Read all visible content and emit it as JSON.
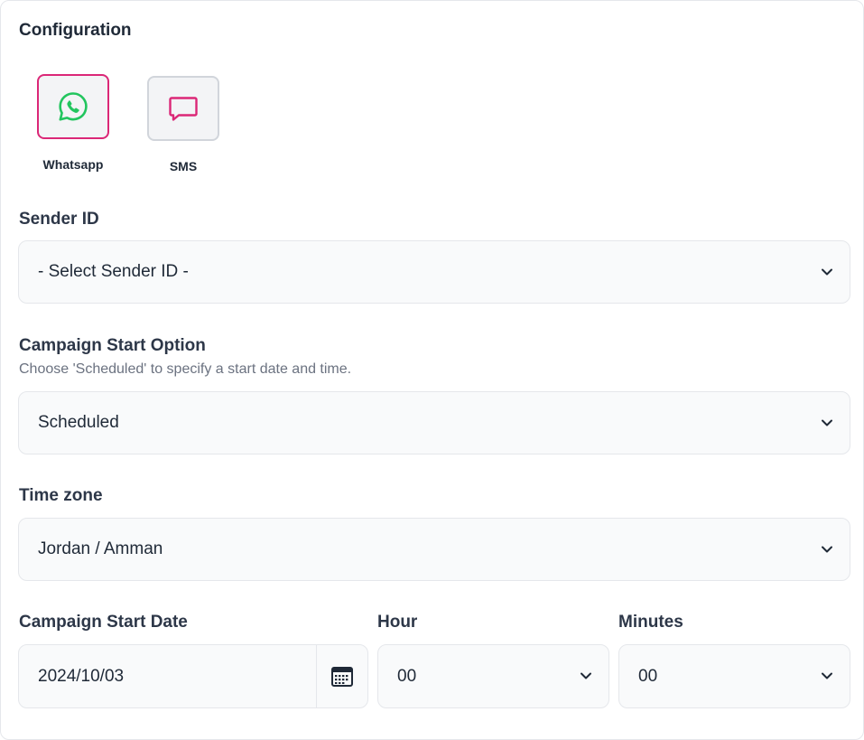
{
  "section_title": "Configuration",
  "channels": [
    {
      "label": "Whatsapp",
      "icon": "whatsapp-icon",
      "selected": true,
      "color": "#22c55e"
    },
    {
      "label": "SMS",
      "icon": "chat-bubble-icon",
      "selected": false,
      "color": "#db2777"
    }
  ],
  "accent_color": "#db2777",
  "sender_id": {
    "label": "Sender ID",
    "value": "- Select Sender ID -"
  },
  "start_option": {
    "label": "Campaign Start Option",
    "help": "Choose 'Scheduled' to specify a start date and time.",
    "value": "Scheduled"
  },
  "timezone": {
    "label": "Time zone",
    "value": "Jordan / Amman"
  },
  "start_date": {
    "label": "Campaign Start Date",
    "value": "2024/10/03",
    "icon": "calendar-icon"
  },
  "hour": {
    "label": "Hour",
    "value": "00"
  },
  "minutes": {
    "label": "Minutes",
    "value": "00"
  }
}
